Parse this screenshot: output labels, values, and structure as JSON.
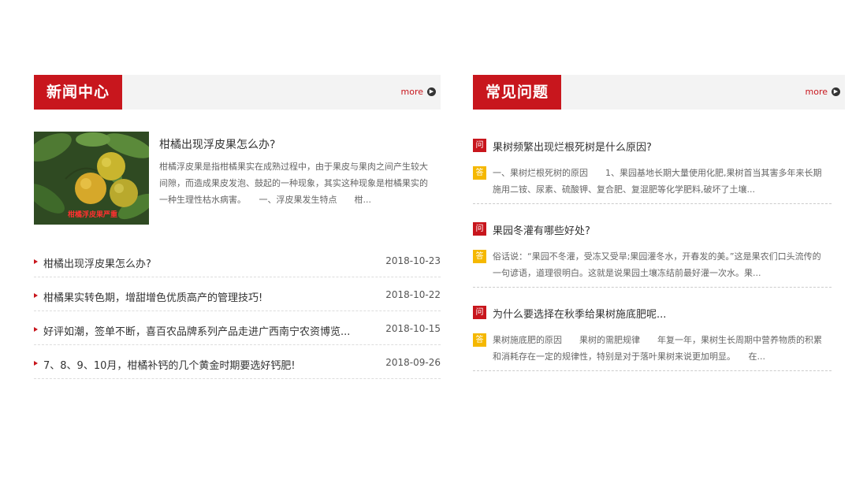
{
  "news": {
    "title": "新闻中心",
    "more": "more",
    "featured": {
      "title": "柑橘出现浮皮果怎么办?",
      "summary": "柑橘浮皮果是指柑橘果实在成熟过程中，由于果皮与果肉之间产生较大间隙，而造成果皮发泡、鼓起的一种现象，其实这种现象是柑橘果实的一种生理性枯水病害。　　一、浮皮果发生特点　　柑...",
      "image_caption": "柑橘浮皮果严重"
    },
    "items": [
      {
        "title": "柑橘出现浮皮果怎么办?",
        "date": "2018-10-23"
      },
      {
        "title": "柑橘果实转色期，增甜增色优质高产的管理技巧!",
        "date": "2018-10-22"
      },
      {
        "title": "好评如潮，签单不断，喜百农品牌系列产品走进广西南宁农资博览...",
        "date": "2018-10-15"
      },
      {
        "title": "7、8、9、10月，柑橘补钙的几个黄金时期要选好钙肥!",
        "date": "2018-09-26"
      }
    ]
  },
  "faq": {
    "title": "常见问题",
    "more": "more",
    "q_label": "问",
    "a_label": "答",
    "items": [
      {
        "question": "果树频繁出现烂根死树是什么原因?",
        "answer": "一、果树烂根死树的原因　　1、果园基地长期大量使用化肥,果树首当其害多年来长期施用二铵、尿素、硫酸钾、复合肥、复混肥等化学肥料,破坏了土壤..."
      },
      {
        "question": "果园冬灌有哪些好处?",
        "answer": "俗话说：“果园不冬灌，受冻又受旱;果园灌冬水，开春发的美。”这是果农们口头流传的一句谚语，道理很明白。这就是说果园土壤冻结前最好灌一次水。果..."
      },
      {
        "question": "为什么要选择在秋季给果树施底肥呢...",
        "answer": "果树施底肥的原因　　果树的需肥规律　　年复一年，果树生长周期中营养物质的积累和消耗存在一定的规律性，特别是对于落叶果树来说更加明显。　　在..."
      }
    ]
  }
}
